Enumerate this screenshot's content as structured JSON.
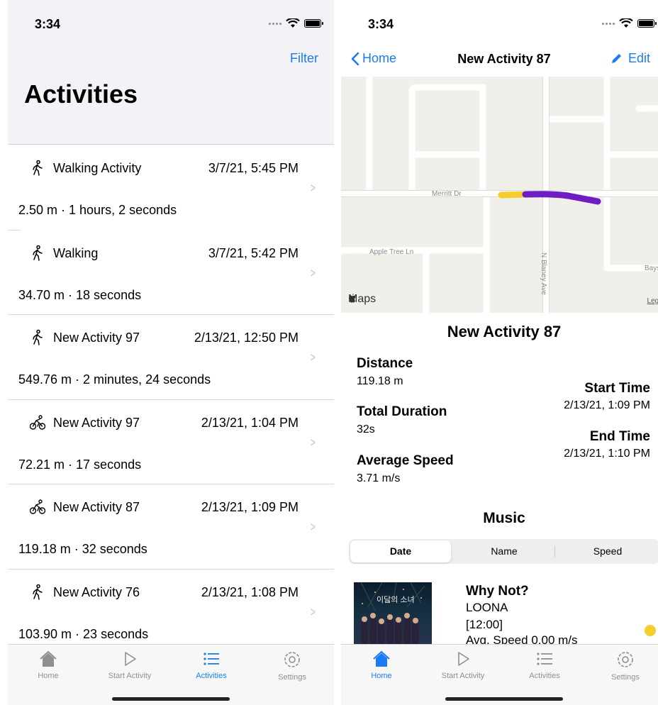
{
  "status": {
    "time": "3:34"
  },
  "left": {
    "filter_label": "Filter",
    "title": "Activities",
    "activities": [
      {
        "icon": "walking-icon",
        "name": "Walking Activity",
        "date": "3/7/21, 5:45 PM",
        "details": "2.50 m  ·  1 hours, 2 seconds"
      },
      {
        "icon": "walking-icon",
        "name": "Walking",
        "date": "3/7/21, 5:42 PM",
        "details": "34.70 m  ·  18 seconds"
      },
      {
        "icon": "walking-icon",
        "name": "New Activity 97",
        "date": "2/13/21, 12:50 PM",
        "details": "549.76 m  ·  2 minutes, 24 seconds"
      },
      {
        "icon": "cycling-icon",
        "name": "New Activity 97",
        "date": "2/13/21, 1:04 PM",
        "details": "72.21 m  ·  17 seconds"
      },
      {
        "icon": "cycling-icon",
        "name": "New Activity 87",
        "date": "2/13/21, 1:09 PM",
        "details": "119.18 m  ·  32 seconds"
      },
      {
        "icon": "walking-icon",
        "name": "New Activity 76",
        "date": "2/13/21, 1:08 PM",
        "details": "103.90 m  ·  23 seconds"
      }
    ],
    "active_tab": "Activities"
  },
  "tabs": [
    {
      "label": "Home",
      "icon": "house-icon"
    },
    {
      "label": "Start Activity",
      "icon": "play-icon"
    },
    {
      "label": "Activities",
      "icon": "list-icon"
    },
    {
      "label": "Settings",
      "icon": "gear-icon"
    }
  ],
  "right": {
    "back_label": "Home",
    "nav_title": "New Activity 87",
    "edit_label": "Edit",
    "map": {
      "street_merritt": "Merritt Dr",
      "street_appletree": "Apple Tree Ln",
      "street_blaney": "N Blaney Ave",
      "street_bays": "Bays",
      "maps_label": "Maps",
      "legal_label": "Legal",
      "route_colors": [
        "#f5cd2c",
        "#6e1dc4"
      ]
    },
    "activity_title": "New Activity 87",
    "distance_label": "Distance",
    "distance_value": "119.18 m",
    "duration_label": "Total Duration",
    "duration_value": "32s",
    "speed_label": "Average Speed",
    "speed_value": "3.71 m/s",
    "start_label": "Start Time",
    "start_value": "2/13/21, 1:09 PM",
    "end_label": "End Time",
    "end_value": "2/13/21, 1:10 PM",
    "music_title": "Music",
    "sort_options": [
      "Date",
      "Name",
      "Speed"
    ],
    "selected_sort": "Date",
    "song": {
      "title": "Why Not?",
      "artist": "LOONA",
      "time": "[12:00]",
      "speed": "Avg. Speed 0.00 m/s",
      "album_text": "이달의 소녀",
      "dot_color": "#f5cd2c"
    },
    "active_tab": "Home"
  }
}
